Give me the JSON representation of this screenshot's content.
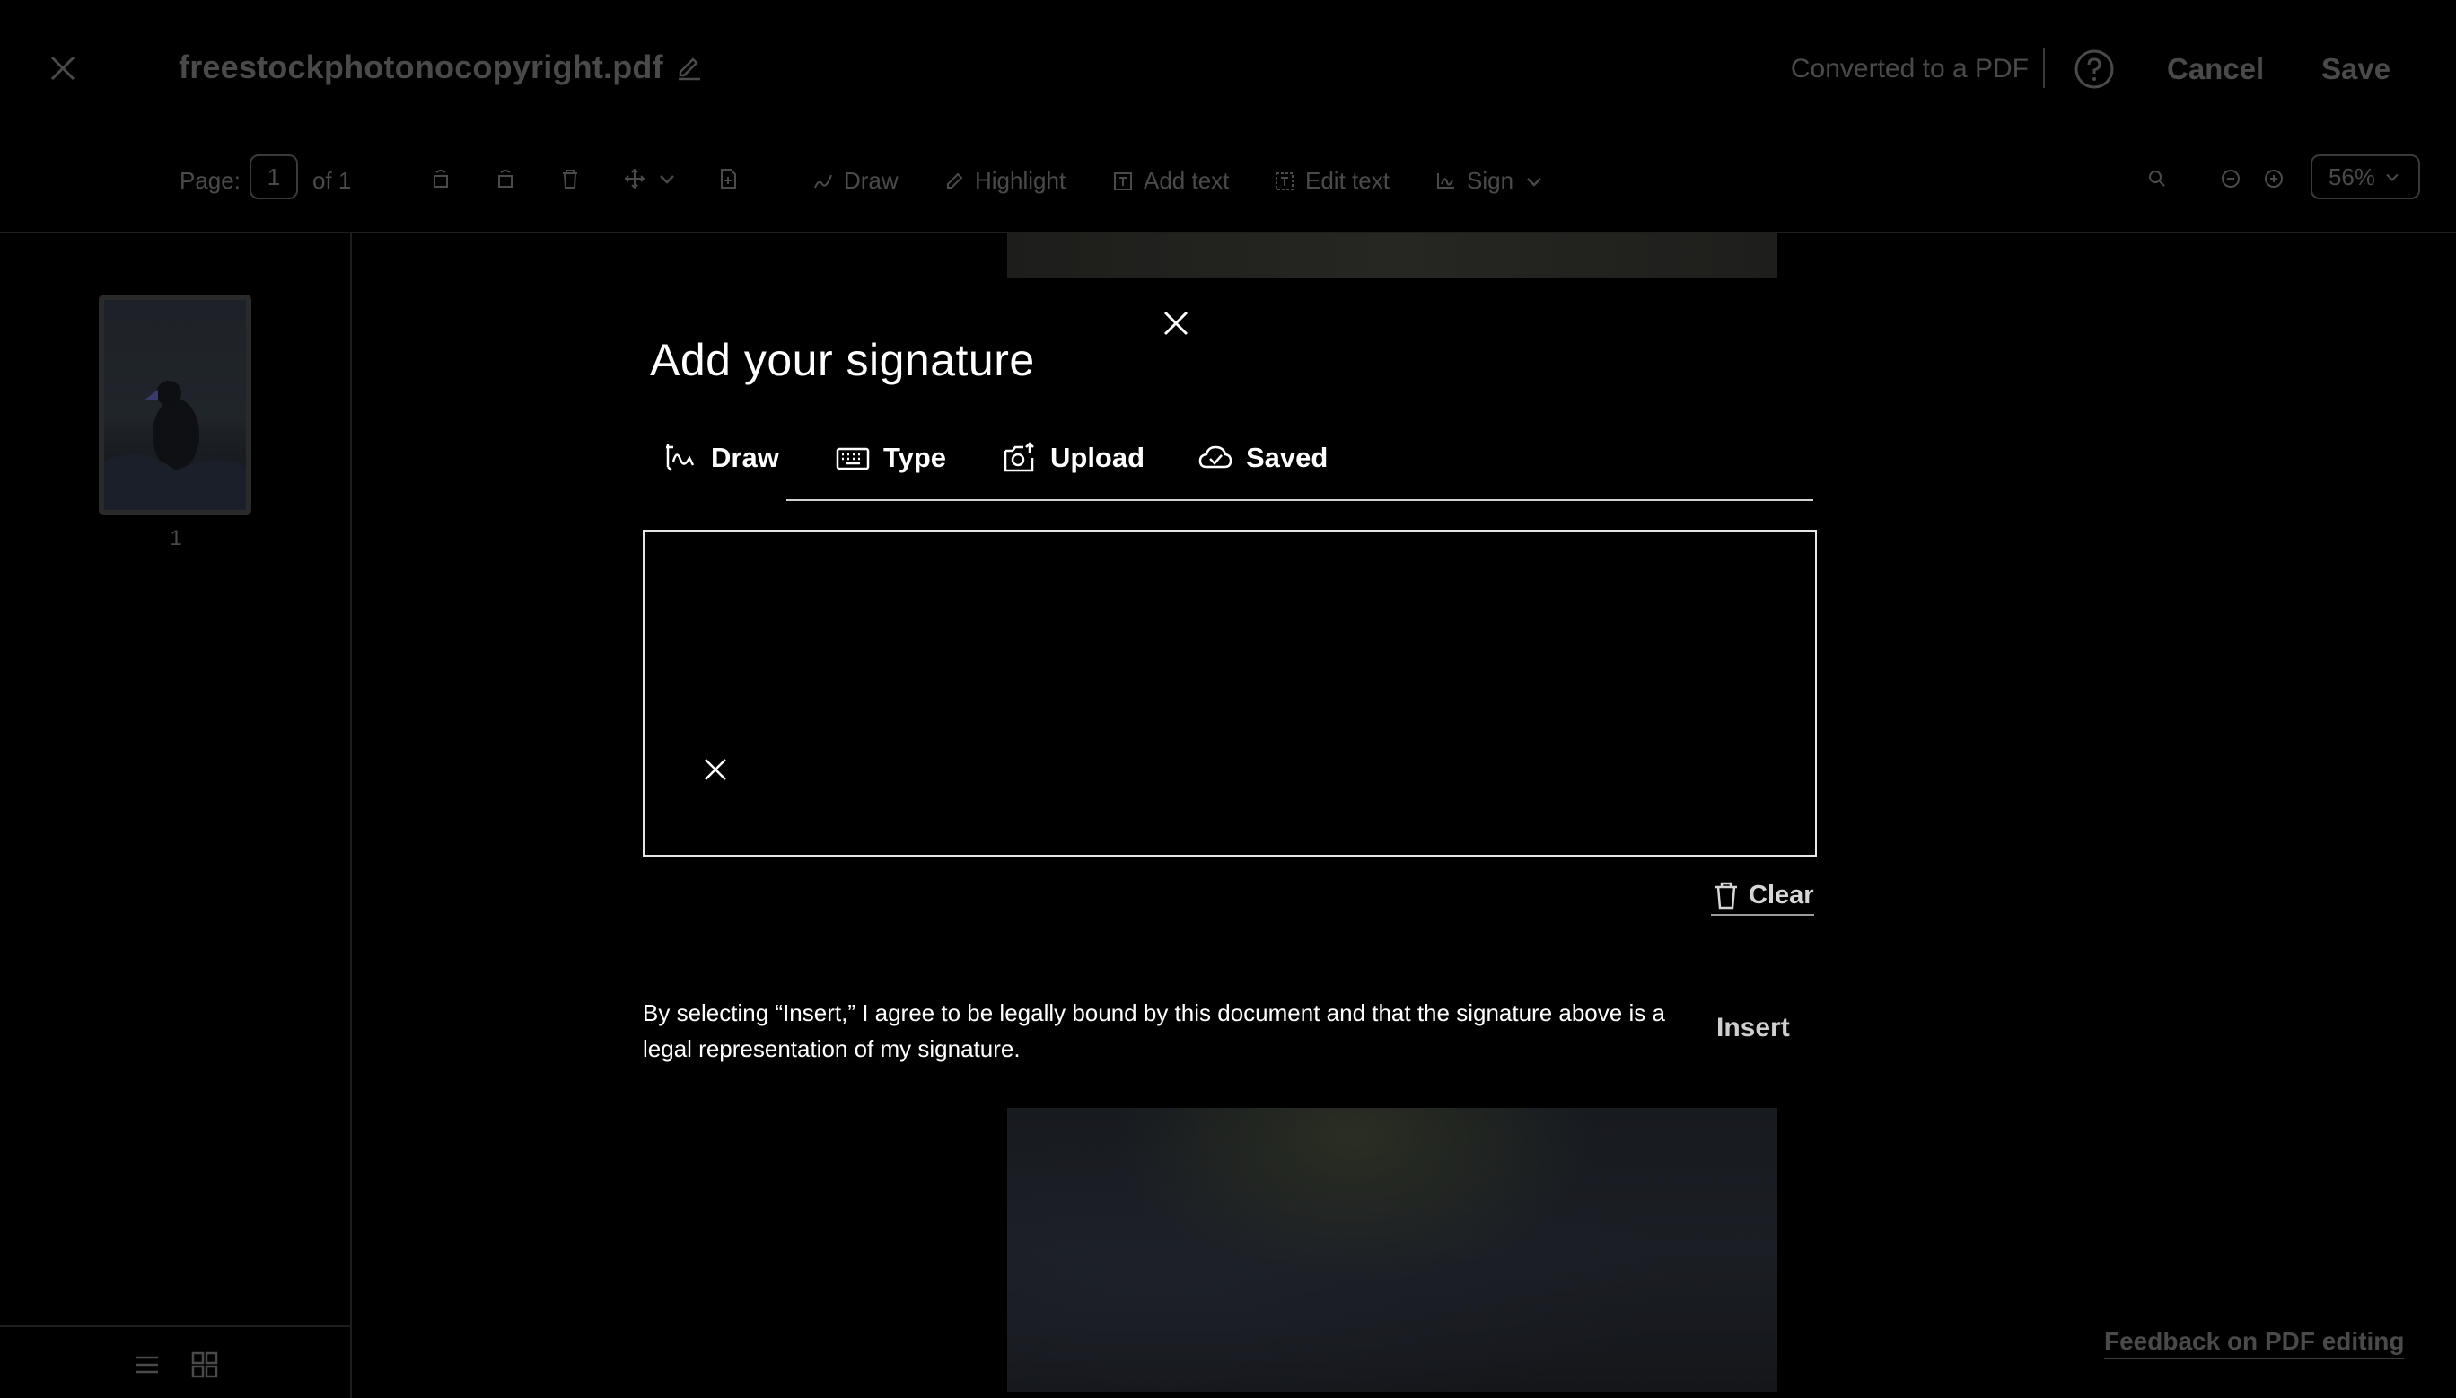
{
  "header": {
    "filename": "freestockphotonocopyright.pdf",
    "status": "Converted to a PDF",
    "cancel_label": "Cancel",
    "save_label": "Save"
  },
  "toolbar": {
    "page_label": "Page:",
    "page_value": "1",
    "page_total": "of 1",
    "draw_label": "Draw",
    "highlight_label": "Highlight",
    "add_text_label": "Add text",
    "edit_text_label": "Edit text",
    "sign_label": "Sign",
    "zoom_value": "56%"
  },
  "sidebar": {
    "thumbnail_page_number": "1"
  },
  "modal": {
    "title": "Add your signature",
    "tabs": [
      {
        "label": "Draw",
        "icon": "signature-pen-icon"
      },
      {
        "label": "Type",
        "icon": "keyboard-icon"
      },
      {
        "label": "Upload",
        "icon": "camera-upload-icon"
      },
      {
        "label": "Saved",
        "icon": "cloud-check-icon"
      }
    ],
    "clear_label": "Clear",
    "legal_text": "By selecting “Insert,” I agree to be legally bound by this document and that the signature above is a legal representation of my signature.",
    "insert_label": "Insert"
  },
  "footer": {
    "feedback_label": "Feedback on PDF editing"
  },
  "colors": {
    "background": "#000000",
    "dimmed_text": "#4a4a4a",
    "modal_text": "#ffffff"
  }
}
